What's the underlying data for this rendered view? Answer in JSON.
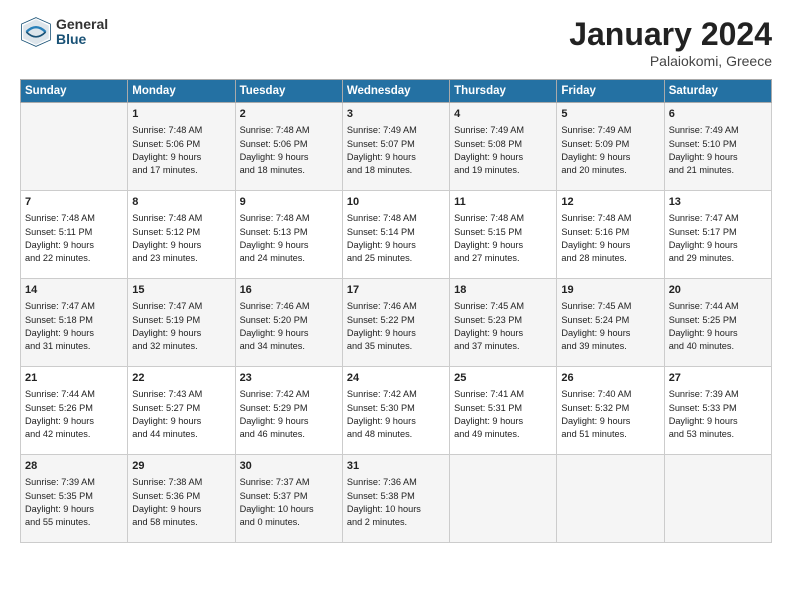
{
  "header": {
    "logo_general": "General",
    "logo_blue": "Blue",
    "title": "January 2024",
    "subtitle": "Palaiokomi, Greece"
  },
  "columns": [
    "Sunday",
    "Monday",
    "Tuesday",
    "Wednesday",
    "Thursday",
    "Friday",
    "Saturday"
  ],
  "weeks": [
    [
      {
        "day": "",
        "lines": []
      },
      {
        "day": "1",
        "lines": [
          "Sunrise: 7:48 AM",
          "Sunset: 5:06 PM",
          "Daylight: 9 hours",
          "and 17 minutes."
        ]
      },
      {
        "day": "2",
        "lines": [
          "Sunrise: 7:48 AM",
          "Sunset: 5:06 PM",
          "Daylight: 9 hours",
          "and 18 minutes."
        ]
      },
      {
        "day": "3",
        "lines": [
          "Sunrise: 7:49 AM",
          "Sunset: 5:07 PM",
          "Daylight: 9 hours",
          "and 18 minutes."
        ]
      },
      {
        "day": "4",
        "lines": [
          "Sunrise: 7:49 AM",
          "Sunset: 5:08 PM",
          "Daylight: 9 hours",
          "and 19 minutes."
        ]
      },
      {
        "day": "5",
        "lines": [
          "Sunrise: 7:49 AM",
          "Sunset: 5:09 PM",
          "Daylight: 9 hours",
          "and 20 minutes."
        ]
      },
      {
        "day": "6",
        "lines": [
          "Sunrise: 7:49 AM",
          "Sunset: 5:10 PM",
          "Daylight: 9 hours",
          "and 21 minutes."
        ]
      }
    ],
    [
      {
        "day": "7",
        "lines": [
          "Sunrise: 7:48 AM",
          "Sunset: 5:11 PM",
          "Daylight: 9 hours",
          "and 22 minutes."
        ]
      },
      {
        "day": "8",
        "lines": [
          "Sunrise: 7:48 AM",
          "Sunset: 5:12 PM",
          "Daylight: 9 hours",
          "and 23 minutes."
        ]
      },
      {
        "day": "9",
        "lines": [
          "Sunrise: 7:48 AM",
          "Sunset: 5:13 PM",
          "Daylight: 9 hours",
          "and 24 minutes."
        ]
      },
      {
        "day": "10",
        "lines": [
          "Sunrise: 7:48 AM",
          "Sunset: 5:14 PM",
          "Daylight: 9 hours",
          "and 25 minutes."
        ]
      },
      {
        "day": "11",
        "lines": [
          "Sunrise: 7:48 AM",
          "Sunset: 5:15 PM",
          "Daylight: 9 hours",
          "and 27 minutes."
        ]
      },
      {
        "day": "12",
        "lines": [
          "Sunrise: 7:48 AM",
          "Sunset: 5:16 PM",
          "Daylight: 9 hours",
          "and 28 minutes."
        ]
      },
      {
        "day": "13",
        "lines": [
          "Sunrise: 7:47 AM",
          "Sunset: 5:17 PM",
          "Daylight: 9 hours",
          "and 29 minutes."
        ]
      }
    ],
    [
      {
        "day": "14",
        "lines": [
          "Sunrise: 7:47 AM",
          "Sunset: 5:18 PM",
          "Daylight: 9 hours",
          "and 31 minutes."
        ]
      },
      {
        "day": "15",
        "lines": [
          "Sunrise: 7:47 AM",
          "Sunset: 5:19 PM",
          "Daylight: 9 hours",
          "and 32 minutes."
        ]
      },
      {
        "day": "16",
        "lines": [
          "Sunrise: 7:46 AM",
          "Sunset: 5:20 PM",
          "Daylight: 9 hours",
          "and 34 minutes."
        ]
      },
      {
        "day": "17",
        "lines": [
          "Sunrise: 7:46 AM",
          "Sunset: 5:22 PM",
          "Daylight: 9 hours",
          "and 35 minutes."
        ]
      },
      {
        "day": "18",
        "lines": [
          "Sunrise: 7:45 AM",
          "Sunset: 5:23 PM",
          "Daylight: 9 hours",
          "and 37 minutes."
        ]
      },
      {
        "day": "19",
        "lines": [
          "Sunrise: 7:45 AM",
          "Sunset: 5:24 PM",
          "Daylight: 9 hours",
          "and 39 minutes."
        ]
      },
      {
        "day": "20",
        "lines": [
          "Sunrise: 7:44 AM",
          "Sunset: 5:25 PM",
          "Daylight: 9 hours",
          "and 40 minutes."
        ]
      }
    ],
    [
      {
        "day": "21",
        "lines": [
          "Sunrise: 7:44 AM",
          "Sunset: 5:26 PM",
          "Daylight: 9 hours",
          "and 42 minutes."
        ]
      },
      {
        "day": "22",
        "lines": [
          "Sunrise: 7:43 AM",
          "Sunset: 5:27 PM",
          "Daylight: 9 hours",
          "and 44 minutes."
        ]
      },
      {
        "day": "23",
        "lines": [
          "Sunrise: 7:42 AM",
          "Sunset: 5:29 PM",
          "Daylight: 9 hours",
          "and 46 minutes."
        ]
      },
      {
        "day": "24",
        "lines": [
          "Sunrise: 7:42 AM",
          "Sunset: 5:30 PM",
          "Daylight: 9 hours",
          "and 48 minutes."
        ]
      },
      {
        "day": "25",
        "lines": [
          "Sunrise: 7:41 AM",
          "Sunset: 5:31 PM",
          "Daylight: 9 hours",
          "and 49 minutes."
        ]
      },
      {
        "day": "26",
        "lines": [
          "Sunrise: 7:40 AM",
          "Sunset: 5:32 PM",
          "Daylight: 9 hours",
          "and 51 minutes."
        ]
      },
      {
        "day": "27",
        "lines": [
          "Sunrise: 7:39 AM",
          "Sunset: 5:33 PM",
          "Daylight: 9 hours",
          "and 53 minutes."
        ]
      }
    ],
    [
      {
        "day": "28",
        "lines": [
          "Sunrise: 7:39 AM",
          "Sunset: 5:35 PM",
          "Daylight: 9 hours",
          "and 55 minutes."
        ]
      },
      {
        "day": "29",
        "lines": [
          "Sunrise: 7:38 AM",
          "Sunset: 5:36 PM",
          "Daylight: 9 hours",
          "and 58 minutes."
        ]
      },
      {
        "day": "30",
        "lines": [
          "Sunrise: 7:37 AM",
          "Sunset: 5:37 PM",
          "Daylight: 10 hours",
          "and 0 minutes."
        ]
      },
      {
        "day": "31",
        "lines": [
          "Sunrise: 7:36 AM",
          "Sunset: 5:38 PM",
          "Daylight: 10 hours",
          "and 2 minutes."
        ]
      },
      {
        "day": "",
        "lines": []
      },
      {
        "day": "",
        "lines": []
      },
      {
        "day": "",
        "lines": []
      }
    ]
  ]
}
